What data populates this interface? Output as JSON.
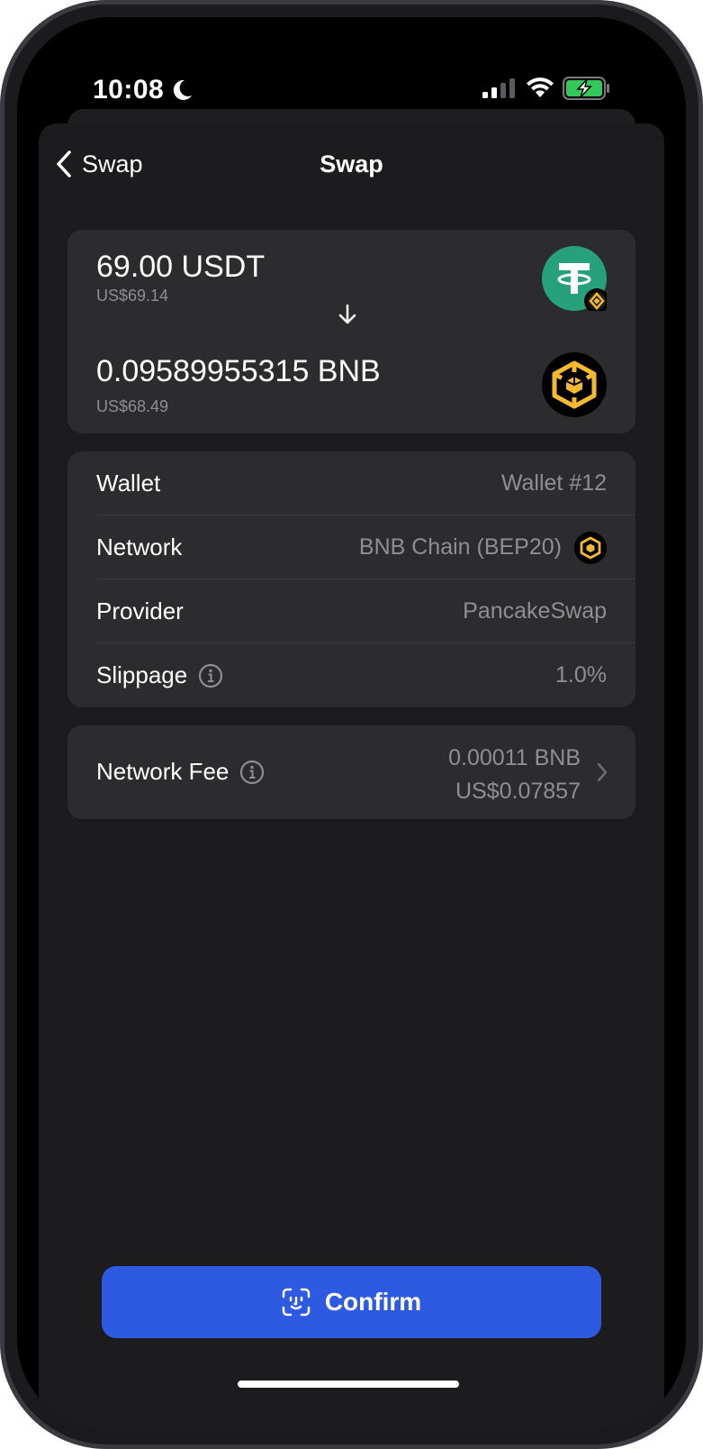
{
  "status_bar": {
    "time": "10:08"
  },
  "nav": {
    "back_label": "Swap",
    "title": "Swap"
  },
  "swap": {
    "from_amount": "69.00 USDT",
    "from_fiat": "US$69.14",
    "to_amount": "0.09589955315 BNB",
    "to_fiat": "US$68.49"
  },
  "details": {
    "wallet_label": "Wallet",
    "wallet_value": "Wallet #12",
    "network_label": "Network",
    "network_value": "BNB Chain (BEP20)",
    "provider_label": "Provider",
    "provider_value": "PancakeSwap",
    "slippage_label": "Slippage",
    "slippage_value": "1.0%"
  },
  "fee": {
    "label": "Network Fee",
    "amount": "0.00011 BNB",
    "fiat": "US$0.07857"
  },
  "confirm_label": "Confirm",
  "colors": {
    "background": "#000000",
    "sheet": "#1c1c1e",
    "card": "#2c2c2e",
    "accent": "#2d5ae0",
    "usdt": "#26a17b",
    "bnb": "#f3ba2f",
    "secondary_text": "#8e8e93"
  },
  "icons": {
    "moon": "moon-icon",
    "signal": "cellular-signal-icon",
    "wifi": "wifi-icon",
    "battery": "battery-charging-icon",
    "back": "chevron-left-icon",
    "arrow": "arrow-down-icon",
    "info": "info-icon",
    "chevron": "chevron-right-icon",
    "face_id": "face-id-icon"
  }
}
